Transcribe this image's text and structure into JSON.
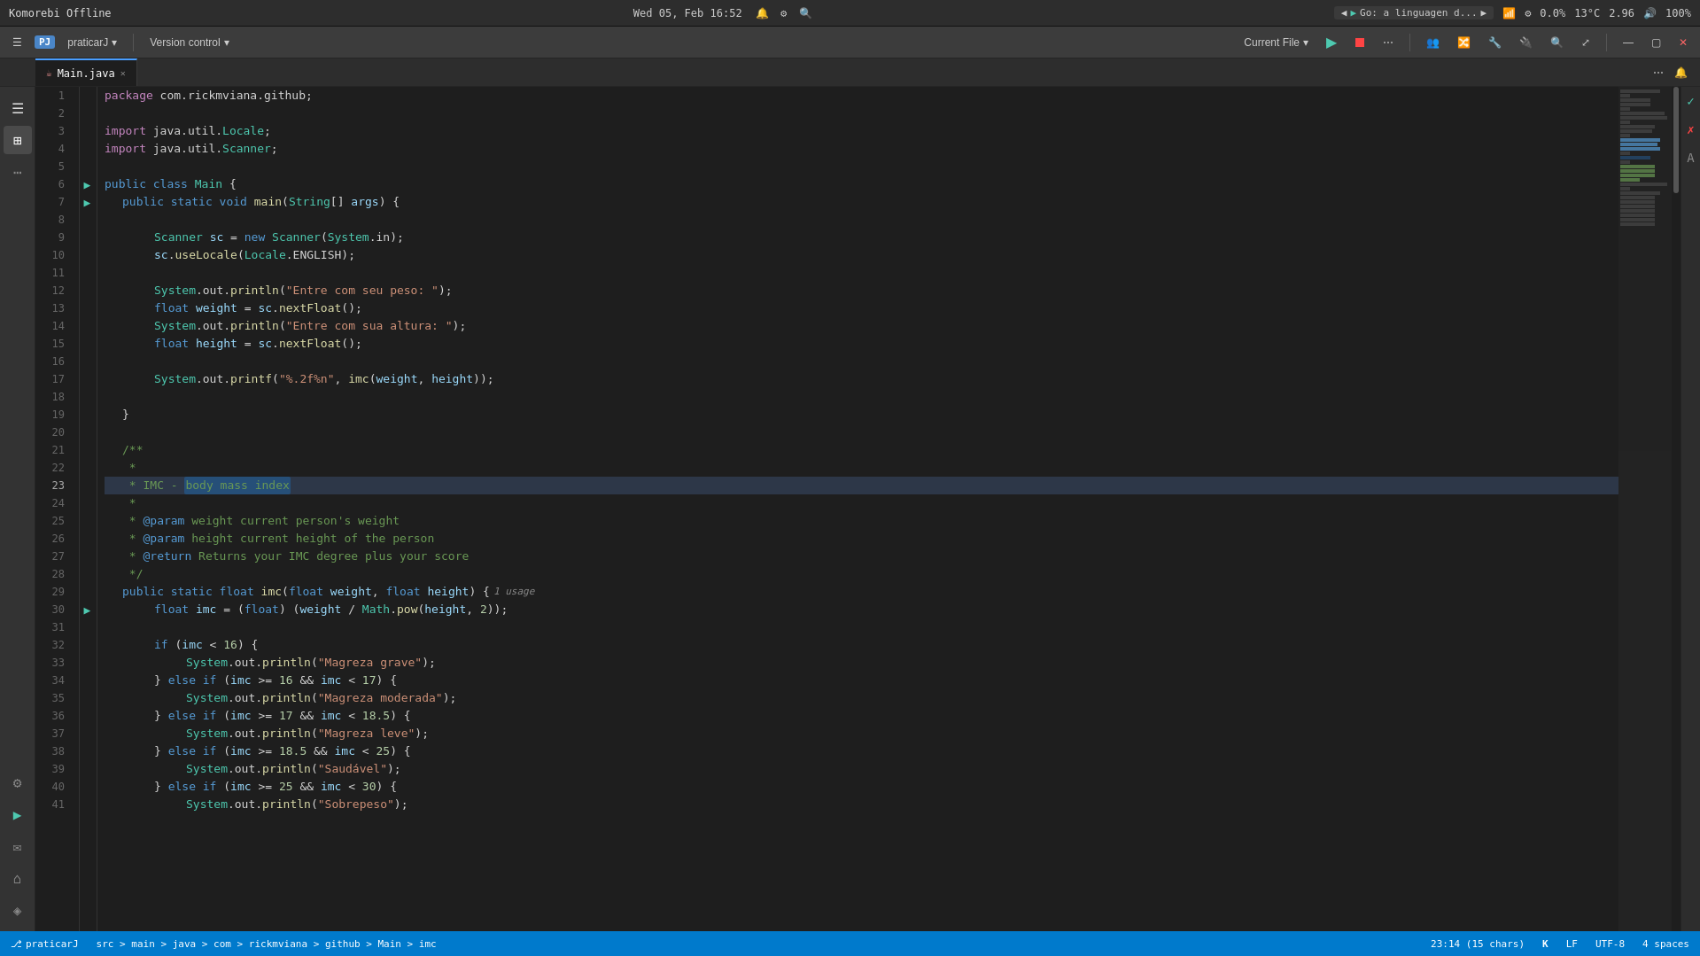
{
  "system_bar": {
    "app_name": "Komorebi Offline",
    "datetime": "Wed 05, Feb 16:52",
    "run_config": "Go: a linguagen d...",
    "network_icon": "wifi",
    "cpu_percent": "0.0%",
    "temp": "13°C",
    "cpu2": "2.96",
    "volume": "100%"
  },
  "ide_toolbar": {
    "project_badge": "PJ",
    "project_name": "praticarJ",
    "vcs_label": "Version control",
    "current_file_label": "Current File",
    "file_label": "Main.java",
    "run_config_label": "Go: a linguagen d..."
  },
  "tabs": [
    {
      "label": "Main.java",
      "active": true,
      "icon": "☕"
    }
  ],
  "editor": {
    "lines": [
      {
        "num": 1,
        "content": "package com.rickmviana.github;",
        "type": "code"
      },
      {
        "num": 2,
        "content": "",
        "type": "empty"
      },
      {
        "num": 3,
        "content": "import java.util.Locale;",
        "type": "code"
      },
      {
        "num": 4,
        "content": "import java.util.Scanner;",
        "type": "code"
      },
      {
        "num": 5,
        "content": "",
        "type": "empty"
      },
      {
        "num": 6,
        "content": "public class Main {",
        "type": "code",
        "runnable": true
      },
      {
        "num": 7,
        "content": "    public static void main(String[] args) {",
        "type": "code",
        "runnable": true
      },
      {
        "num": 8,
        "content": "",
        "type": "empty"
      },
      {
        "num": 9,
        "content": "        Scanner sc = new Scanner(System.in);",
        "type": "code"
      },
      {
        "num": 10,
        "content": "        sc.useLocale(Locale.ENGLISH);",
        "type": "code"
      },
      {
        "num": 11,
        "content": "",
        "type": "empty"
      },
      {
        "num": 12,
        "content": "        System.out.println(\"Entre com seu peso: \");",
        "type": "code"
      },
      {
        "num": 13,
        "content": "        float weight = sc.nextFloat();",
        "type": "code"
      },
      {
        "num": 14,
        "content": "        System.out.println(\"Entre com sua altura: \");",
        "type": "code"
      },
      {
        "num": 15,
        "content": "        float height = sc.nextFloat();",
        "type": "code"
      },
      {
        "num": 16,
        "content": "",
        "type": "empty"
      },
      {
        "num": 17,
        "content": "        System.out.printf(\"%.2f%n\", imc(weight, height));",
        "type": "code"
      },
      {
        "num": 18,
        "content": "",
        "type": "empty"
      },
      {
        "num": 19,
        "content": "    }",
        "type": "code"
      },
      {
        "num": 20,
        "content": "",
        "type": "empty"
      },
      {
        "num": 21,
        "content": "    /**",
        "type": "comment"
      },
      {
        "num": 22,
        "content": "     *",
        "type": "comment"
      },
      {
        "num": 23,
        "content": "     * IMC - body mass index",
        "type": "comment",
        "highlighted": true,
        "selection": "body mass index"
      },
      {
        "num": 24,
        "content": "     *",
        "type": "comment"
      },
      {
        "num": 25,
        "content": "     * @param weight current person's weight",
        "type": "comment"
      },
      {
        "num": 26,
        "content": "     * @param height current height of the person",
        "type": "comment"
      },
      {
        "num": 27,
        "content": "     * @return Returns your IMC degree plus your score",
        "type": "comment"
      },
      {
        "num": 28,
        "content": "     */",
        "type": "comment"
      },
      {
        "num": 29,
        "content": "    public static float imc(float weight, float height) {",
        "type": "code",
        "usage": "1 usage"
      },
      {
        "num": 30,
        "content": "        float imc = (float) (weight / Math.pow(height, 2));",
        "type": "code"
      },
      {
        "num": 31,
        "content": "",
        "type": "empty"
      },
      {
        "num": 32,
        "content": "        if (imc < 16) {",
        "type": "code"
      },
      {
        "num": 33,
        "content": "            System.out.println(\"Magreza grave\");",
        "type": "code"
      },
      {
        "num": 34,
        "content": "        } else if (imc >= 16 && imc < 17) {",
        "type": "code"
      },
      {
        "num": 35,
        "content": "            System.out.println(\"Magreza moderada\");",
        "type": "code"
      },
      {
        "num": 36,
        "content": "        } else if (imc >= 17 && imc < 18.5) {",
        "type": "code"
      },
      {
        "num": 37,
        "content": "            System.out.println(\"Magreza leve\");",
        "type": "code"
      },
      {
        "num": 38,
        "content": "        } else if (imc >= 18.5 && imc < 25) {",
        "type": "code"
      },
      {
        "num": 39,
        "content": "            System.out.println(\"Saudável\");",
        "type": "code"
      },
      {
        "num": 40,
        "content": "        } else if (imc >= 25 && imc < 30) {",
        "type": "code"
      },
      {
        "num": 41,
        "content": "            System.out.println(\"Sobrepeso\");",
        "type": "code"
      }
    ]
  },
  "status_bar": {
    "branch": "praticarJ",
    "path": "src > main > java > com > rickmviana > github > Main > imc",
    "position": "23:14 (15 chars)",
    "kotlin_badge": "K",
    "encoding": "UTF-8",
    "line_ending": "LF",
    "indent": "4 spaces"
  },
  "right_bar_icons": [
    "✓",
    "✗",
    "A"
  ],
  "activity_bar": {
    "icons": [
      "☰",
      "⊞",
      "…",
      "⚙",
      "▶",
      "✉",
      "⌂",
      "◈"
    ]
  }
}
